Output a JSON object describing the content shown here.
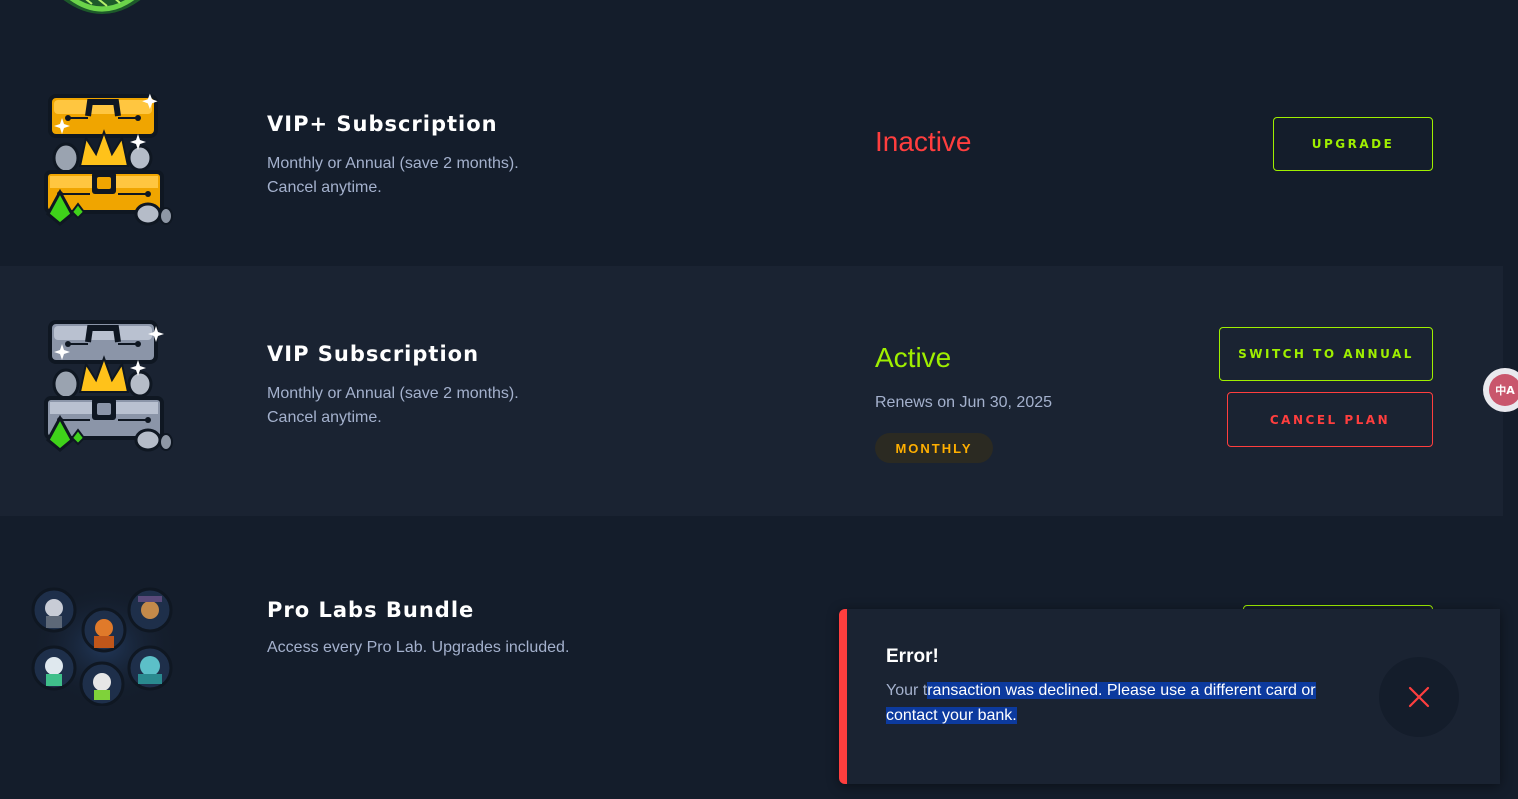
{
  "plans": [
    {
      "title": "VIP+ Subscription",
      "description": [
        "Monthly or Annual (save 2 months).",
        "Cancel anytime."
      ],
      "status": "Inactive",
      "button": "UPGRADE",
      "icon": "golden-treasure-chest-icon"
    },
    {
      "title": "VIP Subscription",
      "description": [
        "Monthly or Annual (save 2 months).",
        "Cancel anytime."
      ],
      "status": "Active",
      "renews": "Renews on Jun 30, 2025",
      "badge": "MONTHLY",
      "buttons": [
        "SWITCH TO ANNUAL",
        "CANCEL PLAN"
      ],
      "icon": "silver-treasure-chest-icon"
    },
    {
      "title": "Pro Labs Bundle",
      "description": [
        "Access every Pro Lab. Upgrades included."
      ],
      "icon": "pro-labs-avatars-icon"
    }
  ],
  "toast": {
    "title": "Error!",
    "message_lead": "Your t",
    "message_selected": "ransaction was declined. Please use a different card or contact your bank."
  },
  "translate_widget": "中A",
  "colors": {
    "background": "#141d2b",
    "row_alt": "#1a2332",
    "accent_green": "#9fef00",
    "error_red": "#ff3e3e",
    "muted_text": "#a4b1cd",
    "badge_orange": "#ffaf00"
  }
}
